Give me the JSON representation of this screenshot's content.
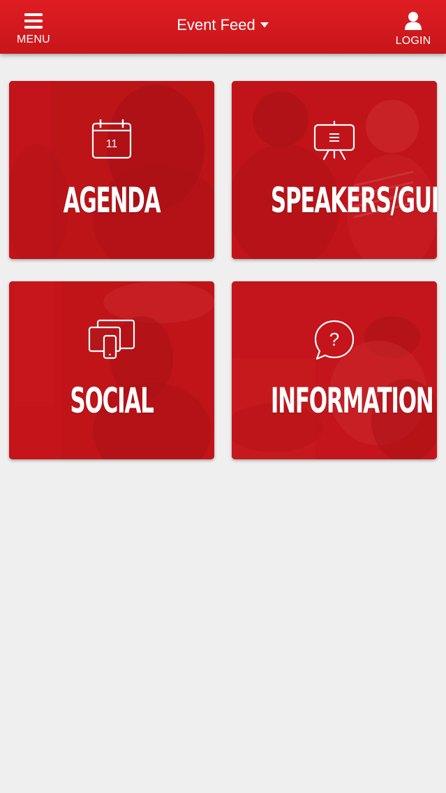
{
  "header": {
    "menu_label": "MENU",
    "menu_icon": "hamburger-icon",
    "title": "Event Feed",
    "title_icon": "caret-down-icon",
    "login_label": "LOGIN",
    "login_icon": "user-icon",
    "color": "#d71920"
  },
  "tiles": [
    {
      "label": "AGENDA",
      "icon": "calendar-icon",
      "icon_text": "11"
    },
    {
      "label": "SPEAKERS/GUESTS",
      "icon": "presentation-easel-icon"
    },
    {
      "label": "SOCIAL",
      "icon": "devices-icon"
    },
    {
      "label": "INFORMATION",
      "icon": "question-bubble-icon"
    }
  ]
}
